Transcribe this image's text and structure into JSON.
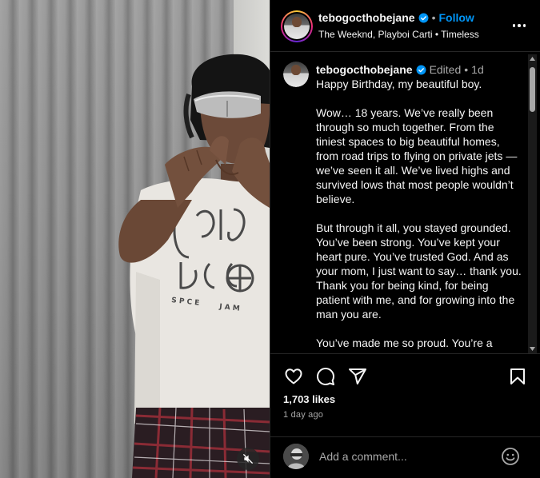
{
  "post": {
    "username": "tebogocthobejane",
    "follow_label": "Follow",
    "separator": "•",
    "audio_text": "The Weeknd, Playboi Carti • Timeless"
  },
  "caption": {
    "username": "tebogocthobejane",
    "edited_label": "Edited",
    "age": "1d",
    "separator": "•",
    "paragraphs": [
      "Happy Birthday, my beautiful boy.",
      "Wow… 18 years. We’ve really been through so much together. From the tiniest spaces to big beautiful homes, from road trips to flying on private jets — we’ve seen it all. We’ve lived highs and survived lows that most people wouldn’t believe.",
      "But through it all, you stayed grounded. You’ve been strong. You’ve kept your heart pure. You’ve trusted God. And as your mom, I just want to say… thank you. Thank you for being kind, for being patient with me, and for growing into the man you are.",
      "You’ve made me so proud. You’re a gentle, generous, beautiful person of character"
    ]
  },
  "actions": {
    "likes": "1,703 likes",
    "time": "1 day ago"
  },
  "comment": {
    "placeholder": "Add a comment..."
  },
  "colors": {
    "accent": "#0095f6",
    "background": "#000000",
    "muted": "#a8a8a8",
    "divider": "#262626"
  },
  "icons": [
    "mute-icon",
    "verified-badge-icon",
    "more-options-icon",
    "heart-icon",
    "comment-icon",
    "share-icon",
    "bookmark-icon",
    "emoji-icon"
  ]
}
